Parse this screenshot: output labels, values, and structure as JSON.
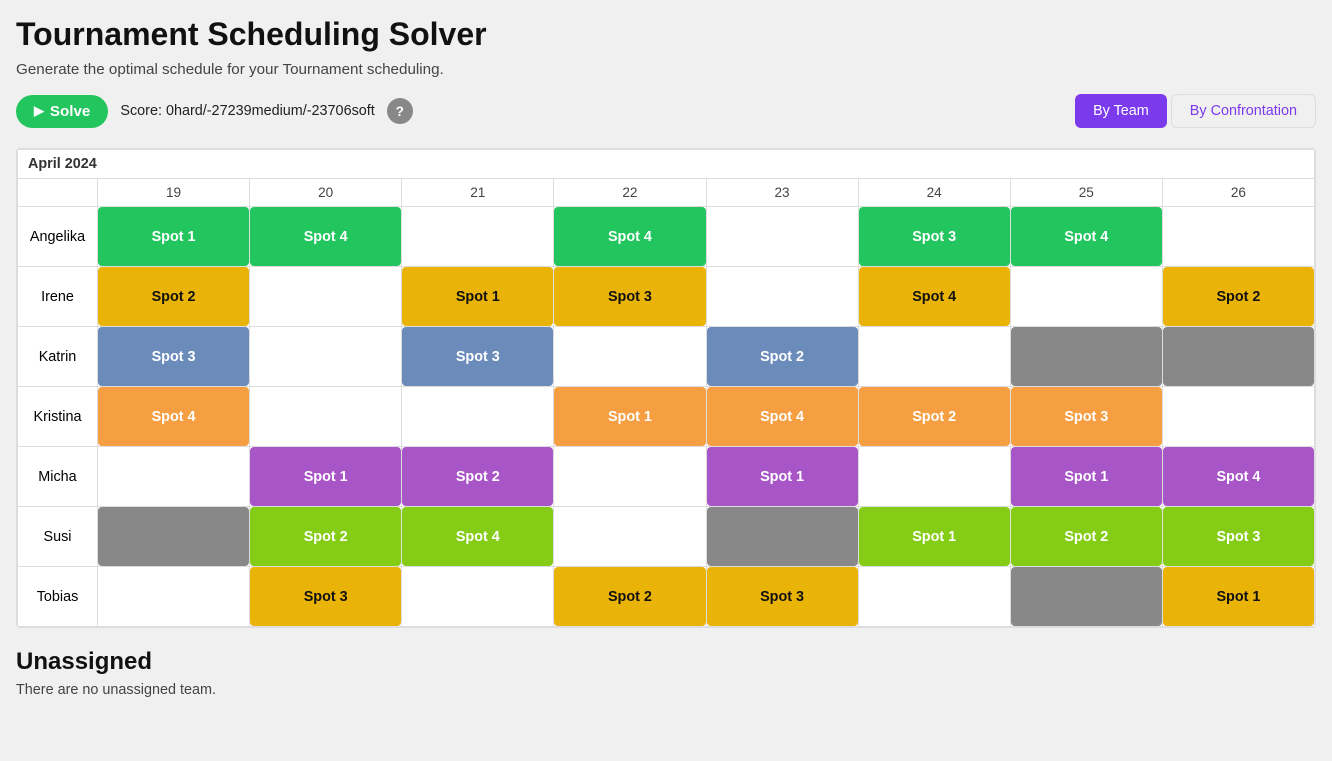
{
  "app": {
    "title": "Tournament Scheduling Solver",
    "subtitle": "Generate the optimal schedule for your Tournament scheduling.",
    "solve_label": "Solve",
    "score_label": "Score: 0hard/-27239medium/-23706soft",
    "help_label": "?",
    "view_by_team": "By Team",
    "view_by_confrontation": "By Confrontation"
  },
  "schedule": {
    "month": "April 2024",
    "days": [
      "19",
      "20",
      "21",
      "22",
      "23",
      "24",
      "25",
      "26"
    ],
    "teams": [
      {
        "name": "Angelika",
        "slots": [
          {
            "day": "19",
            "spot": "Spot 1",
            "color": "spot-green"
          },
          {
            "day": "20",
            "spot": "Spot 4",
            "color": "spot-green"
          },
          {
            "day": "21",
            "spot": "",
            "color": ""
          },
          {
            "day": "22",
            "spot": "Spot 4",
            "color": "spot-green"
          },
          {
            "day": "23",
            "spot": "",
            "color": ""
          },
          {
            "day": "24",
            "spot": "Spot 3",
            "color": "spot-green"
          },
          {
            "day": "25",
            "spot": "Spot 4",
            "color": "spot-green"
          },
          {
            "day": "26",
            "spot": "",
            "color": ""
          }
        ]
      },
      {
        "name": "Irene",
        "slots": [
          {
            "day": "19",
            "spot": "Spot 2",
            "color": "spot-yellow"
          },
          {
            "day": "20",
            "spot": "",
            "color": ""
          },
          {
            "day": "21",
            "spot": "Spot 1",
            "color": "spot-yellow"
          },
          {
            "day": "22",
            "spot": "Spot 3",
            "color": "spot-yellow"
          },
          {
            "day": "23",
            "spot": "",
            "color": ""
          },
          {
            "day": "24",
            "spot": "Spot 4",
            "color": "spot-yellow"
          },
          {
            "day": "25",
            "spot": "",
            "color": ""
          },
          {
            "day": "26",
            "spot": "Spot 2",
            "color": "spot-yellow"
          }
        ]
      },
      {
        "name": "Katrin",
        "slots": [
          {
            "day": "19",
            "spot": "Spot 3",
            "color": "spot-blue"
          },
          {
            "day": "20",
            "spot": "",
            "color": ""
          },
          {
            "day": "21",
            "spot": "Spot 3",
            "color": "spot-blue"
          },
          {
            "day": "22",
            "spot": "",
            "color": ""
          },
          {
            "day": "23",
            "spot": "Spot 2",
            "color": "spot-blue"
          },
          {
            "day": "24",
            "spot": "",
            "color": ""
          },
          {
            "day": "25",
            "spot": "",
            "color": "spot-gray"
          },
          {
            "day": "26",
            "spot": "",
            "color": "spot-gray"
          }
        ]
      },
      {
        "name": "Kristina",
        "slots": [
          {
            "day": "19",
            "spot": "Spot 4",
            "color": "spot-orange"
          },
          {
            "day": "20",
            "spot": "",
            "color": ""
          },
          {
            "day": "21",
            "spot": "",
            "color": ""
          },
          {
            "day": "22",
            "spot": "Spot 1",
            "color": "spot-orange"
          },
          {
            "day": "23",
            "spot": "Spot 4",
            "color": "spot-orange"
          },
          {
            "day": "24",
            "spot": "Spot 2",
            "color": "spot-orange"
          },
          {
            "day": "25",
            "spot": "Spot 3",
            "color": "spot-orange"
          },
          {
            "day": "26",
            "spot": "",
            "color": ""
          }
        ]
      },
      {
        "name": "Micha",
        "slots": [
          {
            "day": "19",
            "spot": "",
            "color": ""
          },
          {
            "day": "20",
            "spot": "Spot 1",
            "color": "spot-purple"
          },
          {
            "day": "21",
            "spot": "Spot 2",
            "color": "spot-purple"
          },
          {
            "day": "22",
            "spot": "",
            "color": ""
          },
          {
            "day": "23",
            "spot": "Spot 1",
            "color": "spot-purple"
          },
          {
            "day": "24",
            "spot": "",
            "color": ""
          },
          {
            "day": "25",
            "spot": "Spot 1",
            "color": "spot-purple"
          },
          {
            "day": "26",
            "spot": "Spot 4",
            "color": "spot-purple"
          }
        ]
      },
      {
        "name": "Susi",
        "slots": [
          {
            "day": "19",
            "spot": "",
            "color": "spot-gray"
          },
          {
            "day": "20",
            "spot": "Spot 2",
            "color": "spot-lime"
          },
          {
            "day": "21",
            "spot": "Spot 4",
            "color": "spot-lime"
          },
          {
            "day": "22",
            "spot": "",
            "color": ""
          },
          {
            "day": "23",
            "spot": "",
            "color": "spot-gray"
          },
          {
            "day": "24",
            "spot": "Spot 1",
            "color": "spot-lime"
          },
          {
            "day": "25",
            "spot": "Spot 2",
            "color": "spot-lime"
          },
          {
            "day": "26",
            "spot": "Spot 3",
            "color": "spot-lime"
          }
        ]
      },
      {
        "name": "Tobias",
        "slots": [
          {
            "day": "19",
            "spot": "",
            "color": ""
          },
          {
            "day": "20",
            "spot": "Spot 3",
            "color": "spot-yellow"
          },
          {
            "day": "21",
            "spot": "",
            "color": ""
          },
          {
            "day": "22",
            "spot": "Spot 2",
            "color": "spot-yellow"
          },
          {
            "day": "23",
            "spot": "Spot 3",
            "color": "spot-yellow"
          },
          {
            "day": "24",
            "spot": "",
            "color": ""
          },
          {
            "day": "25",
            "spot": "",
            "color": "spot-gray"
          },
          {
            "day": "26",
            "spot": "Spot 1",
            "color": "spot-yellow"
          }
        ]
      }
    ]
  },
  "unassigned": {
    "title": "Unassigned",
    "message": "There are no unassigned team."
  }
}
